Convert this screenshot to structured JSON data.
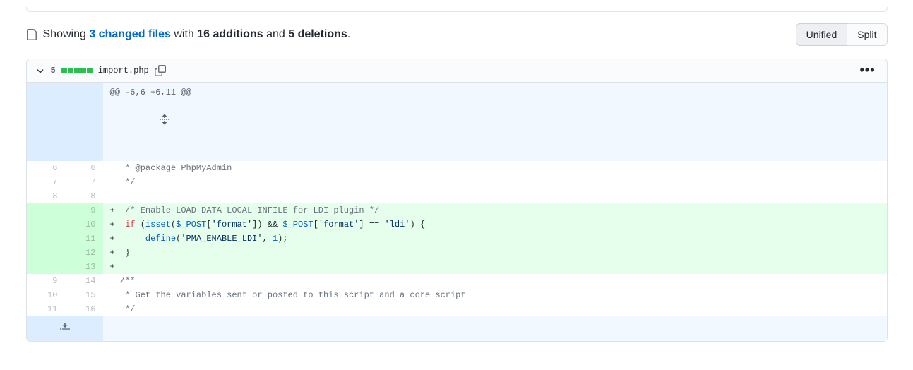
{
  "summary": {
    "showing": "Showing ",
    "changed_files": "3 changed files",
    "middle": " with ",
    "additions": "16 additions",
    "and": " and ",
    "deletions": "5 deletions",
    "period": "."
  },
  "view_toggle": {
    "unified": "Unified",
    "split": "Split"
  },
  "file": {
    "change_count": "5",
    "name": "import.php"
  },
  "hunk": {
    "header": "@@ -6,6 +6,11 @@"
  },
  "lines": [
    {
      "type": "context",
      "old": "6",
      "new": "6",
      "prefix": " ",
      "html": "<span class='com'> * @package PhpMyAdmin</span>"
    },
    {
      "type": "context",
      "old": "7",
      "new": "7",
      "prefix": " ",
      "html": "<span class='com'> */</span>"
    },
    {
      "type": "context",
      "old": "8",
      "new": "8",
      "prefix": " ",
      "html": ""
    },
    {
      "type": "addition",
      "old": "",
      "new": "9",
      "prefix": "+",
      "html": " <span class='com'>/* Enable LOAD DATA LOCAL INFILE for LDI plugin */</span>"
    },
    {
      "type": "addition",
      "old": "",
      "new": "10",
      "prefix": "+",
      "html": " <span class='kw'>if</span> (<span class='fn'>isset</span>(<span class='pds'>$_POST</span>[<span class='str'>'format'</span>]) &amp;&amp; <span class='pds'>$_POST</span>[<span class='str'>'format'</span>] == <span class='str'>'ldi'</span>) {"
    },
    {
      "type": "addition",
      "old": "",
      "new": "11",
      "prefix": "+",
      "html": "     <span class='fn'>define</span>(<span class='str'>'PMA_ENABLE_LDI'</span>, <span class='num-lit'>1</span>);"
    },
    {
      "type": "addition",
      "old": "",
      "new": "12",
      "prefix": "+",
      "html": " }"
    },
    {
      "type": "addition",
      "old": "",
      "new": "13",
      "prefix": "+",
      "html": ""
    },
    {
      "type": "context",
      "old": "9",
      "new": "14",
      "prefix": " ",
      "html": "<span class='com'>/**</span>"
    },
    {
      "type": "context",
      "old": "10",
      "new": "15",
      "prefix": " ",
      "html": "<span class='com'> * Get the variables sent or posted to this script and a core script</span>"
    },
    {
      "type": "context",
      "old": "11",
      "new": "16",
      "prefix": " ",
      "html": "<span class='com'> */</span>"
    }
  ]
}
